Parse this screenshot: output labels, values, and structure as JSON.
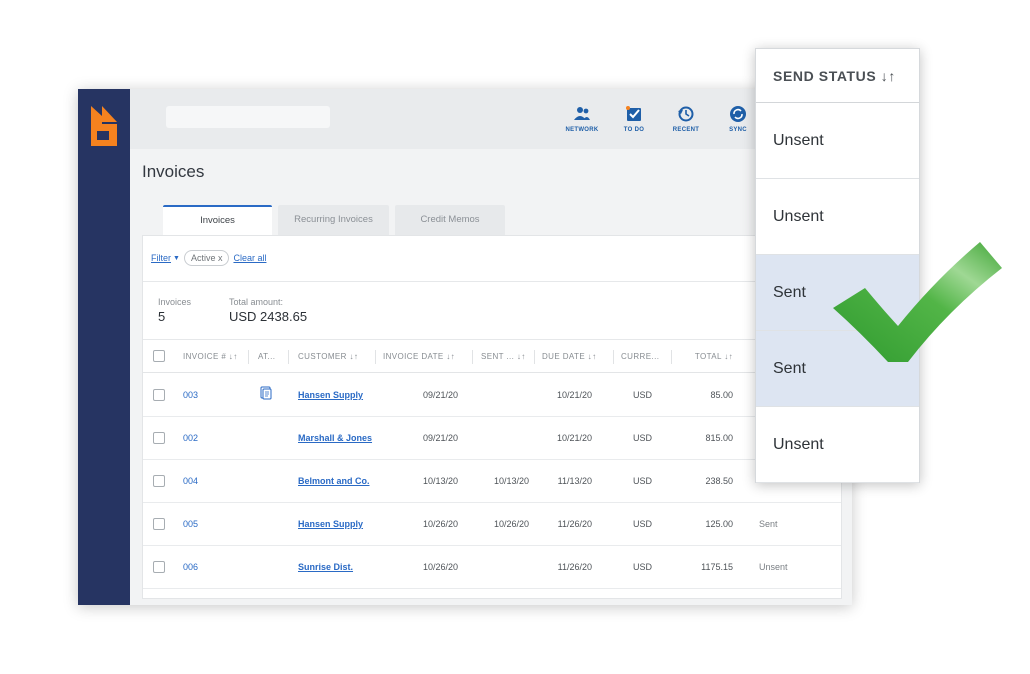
{
  "toolbar": {
    "items": [
      {
        "label": "NETWORK",
        "icon": "network-icon"
      },
      {
        "label": "TO DO",
        "icon": "todo-icon"
      },
      {
        "label": "RECENT",
        "icon": "recent-icon"
      },
      {
        "label": "SYNC",
        "icon": "sync-icon"
      }
    ]
  },
  "page": {
    "title": "Invoices"
  },
  "tabs": [
    {
      "label": "Invoices",
      "active": true
    },
    {
      "label": "Recurring Invoices",
      "active": false
    },
    {
      "label": "Credit Memos",
      "active": false
    }
  ],
  "filter": {
    "label": "Filter",
    "chip": "Active x",
    "clear": "Clear all"
  },
  "summary": {
    "invoices_label": "Invoices",
    "invoices_count": "5",
    "total_label": "Total amount:",
    "total_value": "USD 2438.65"
  },
  "table": {
    "columns": [
      "INVOICE # ↓↑",
      "AT...",
      "CUSTOMER ↓↑",
      "INVOICE DATE ↓↑",
      "SENT ... ↓↑",
      "DUE DATE ↓↑",
      "CURRE...",
      "TOTAL ↓↑"
    ],
    "rows": [
      {
        "invoice": "003",
        "attachment": true,
        "customer": "Hansen Supply",
        "invoice_date": "09/21/20",
        "sent": "",
        "due": "10/21/20",
        "currency": "USD",
        "total": "85.00",
        "status": ""
      },
      {
        "invoice": "002",
        "attachment": false,
        "customer": "Marshall & Jones",
        "invoice_date": "09/21/20",
        "sent": "",
        "due": "10/21/20",
        "currency": "USD",
        "total": "815.00",
        "status": ""
      },
      {
        "invoice": "004",
        "attachment": false,
        "customer": "Belmont and Co.",
        "invoice_date": "10/13/20",
        "sent": "10/13/20",
        "due": "11/13/20",
        "currency": "USD",
        "total": "238.50",
        "status": ""
      },
      {
        "invoice": "005",
        "attachment": false,
        "customer": "Hansen Supply",
        "invoice_date": "10/26/20",
        "sent": "10/26/20",
        "due": "11/26/20",
        "currency": "USD",
        "total": "125.00",
        "status": "Sent"
      },
      {
        "invoice": "006",
        "attachment": false,
        "customer": "Sunrise Dist.",
        "invoice_date": "10/26/20",
        "sent": "",
        "due": "11/26/20",
        "currency": "USD",
        "total": "1175.15",
        "status": "Unsent"
      }
    ]
  },
  "send_status_panel": {
    "header": "SEND STATUS ↓↑",
    "items": [
      "Unsent",
      "Unsent",
      "Sent",
      "Sent",
      "Unsent"
    ]
  },
  "colors": {
    "rail": "#263462",
    "logo_orange": "#f5821f",
    "link_blue": "#2a6ac5",
    "sent_highlight": "#dde5f2",
    "check_green": "#3fa535"
  }
}
